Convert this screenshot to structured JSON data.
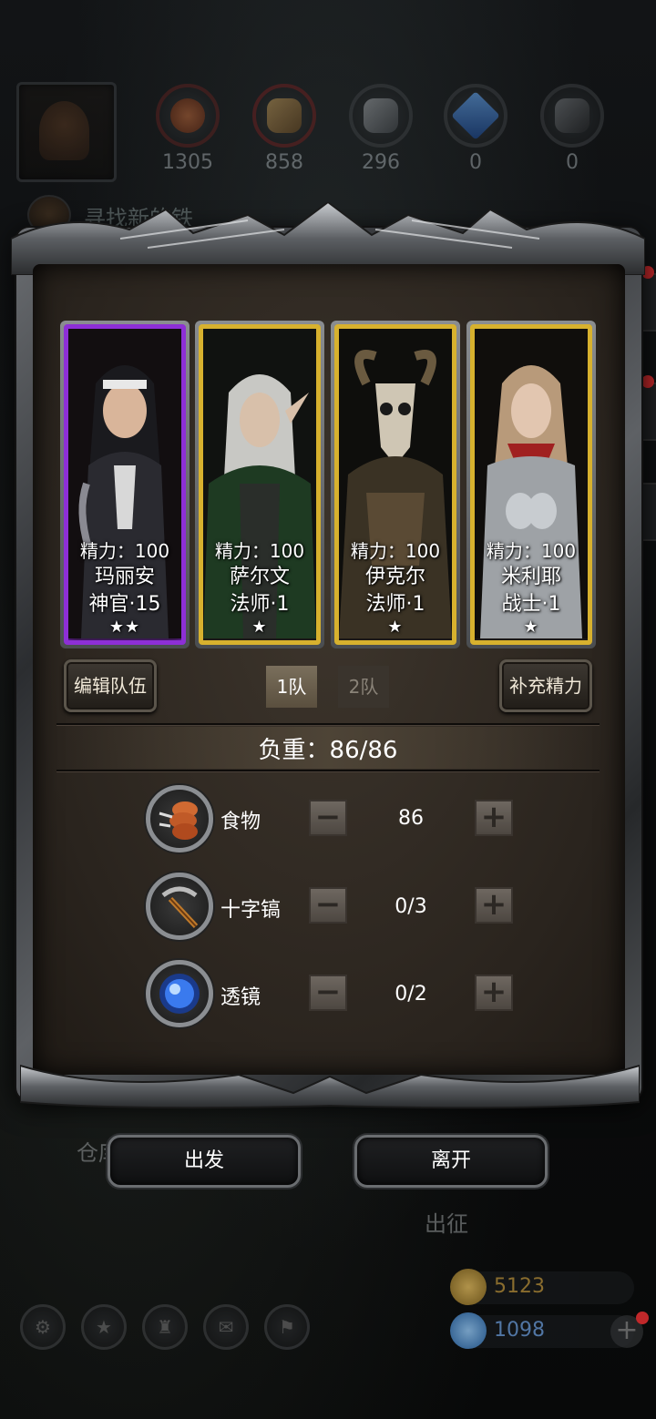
{
  "resources": [
    {
      "name": "food-resource",
      "value": "1305",
      "color": "#a2512a"
    },
    {
      "name": "wood-resource",
      "value": "858",
      "color": "#8a6a3a"
    },
    {
      "name": "stone-resource",
      "value": "296",
      "color": "#7a7e82"
    },
    {
      "name": "crystal-resource",
      "value": "0",
      "color": "#2a6ac8"
    },
    {
      "name": "iron-resource",
      "value": "0",
      "color": "#5a5e62"
    }
  ],
  "quest": {
    "text": "寻找新的铁"
  },
  "heroes": [
    {
      "energy": "精力：100",
      "name": "玛丽安",
      "class": "神官·15",
      "stars": "★★",
      "frame": "purple"
    },
    {
      "energy": "精力：100",
      "name": "萨尔文",
      "class": "法师·1",
      "stars": "★",
      "frame": "gold"
    },
    {
      "energy": "精力：100",
      "name": "伊克尔",
      "class": "法师·1",
      "stars": "★",
      "frame": "gold"
    },
    {
      "energy": "精力：100",
      "name": "米利耶",
      "class": "战士·1",
      "stars": "★",
      "frame": "gold"
    }
  ],
  "team": {
    "edit_label": "编辑队伍",
    "tab1": "1队",
    "tab2": "2队",
    "refill_label": "补充精力",
    "active_tab": "1队"
  },
  "load": {
    "text": "负重：86/86"
  },
  "items": [
    {
      "label": "食物",
      "value": "86",
      "icon": "food-icon"
    },
    {
      "label": "十字镐",
      "value": "0/3",
      "icon": "pickaxe-icon"
    },
    {
      "label": "透镜",
      "value": "0/2",
      "icon": "lens-icon"
    }
  ],
  "stepper": {
    "minus": "−",
    "plus": "+"
  },
  "actions": {
    "depart": "出发",
    "leave": "离开"
  },
  "background_labels": {
    "warehouse": "仓库",
    "expedition": "出征"
  },
  "currency": {
    "gold": "5123",
    "gems": "1098",
    "plus": "+"
  },
  "nav": [
    "settings-icon",
    "achievement-icon",
    "hero-icon",
    "mail-icon",
    "guild-icon"
  ]
}
